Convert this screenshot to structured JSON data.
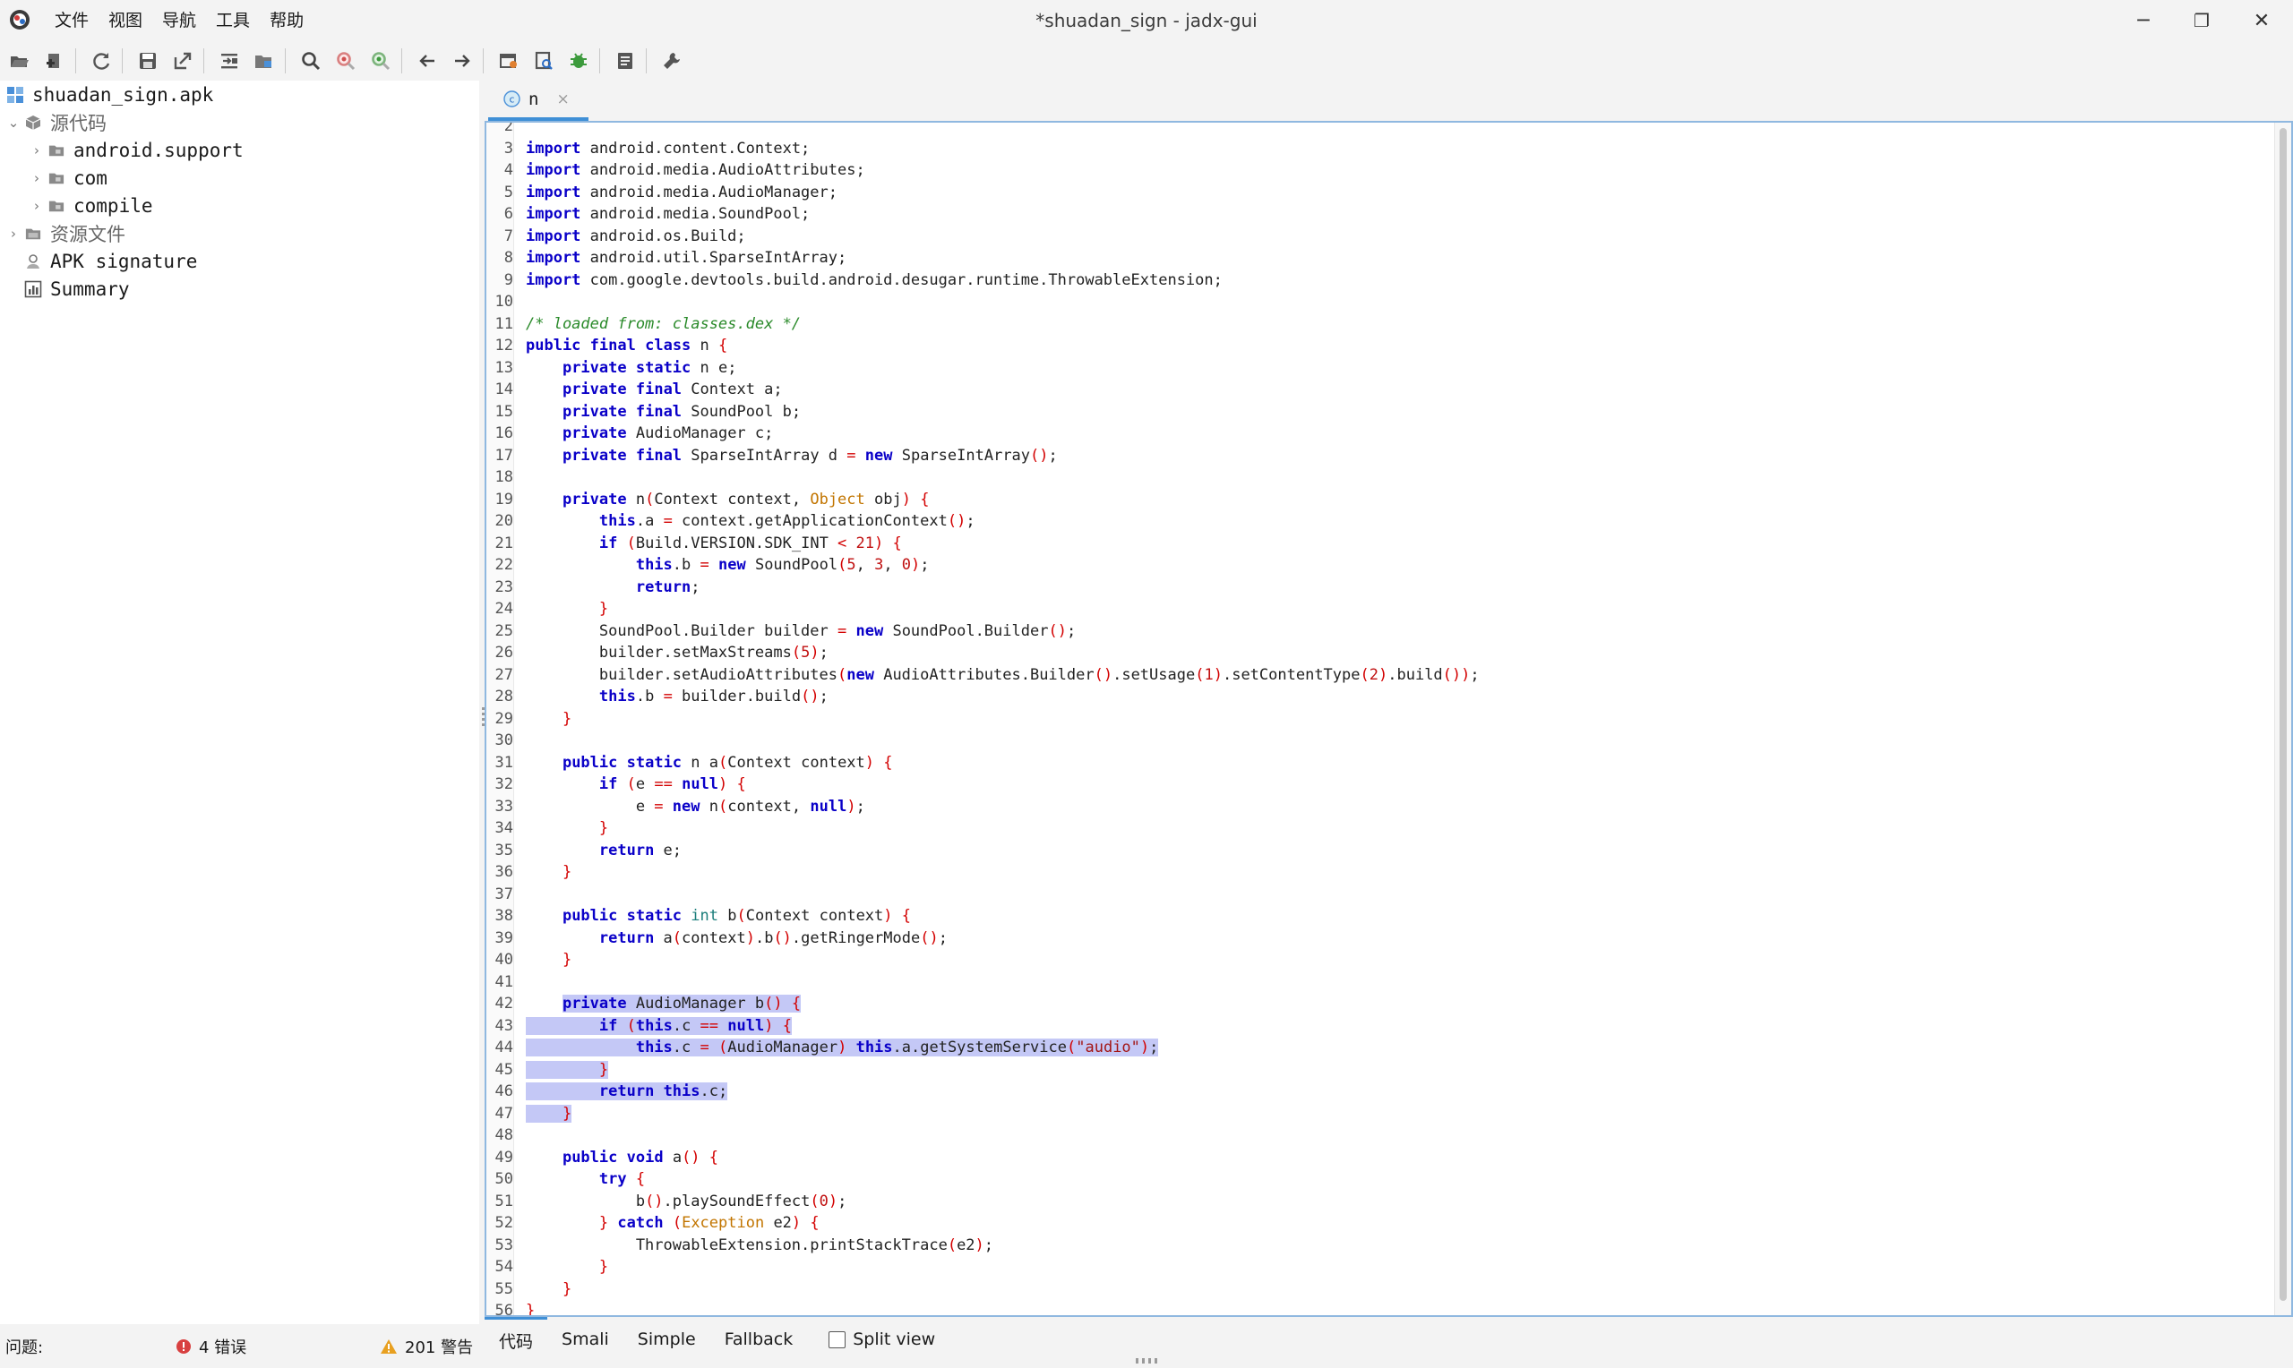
{
  "window": {
    "title": "*shuadan_sign - jadx-gui",
    "minimize_glyph": "─",
    "maximize_glyph": "❐",
    "close_glyph": "✕"
  },
  "menu": [
    "文件",
    "视图",
    "导航",
    "工具",
    "帮助"
  ],
  "toolbar_icons": [
    "open-file-icon",
    "add-files-icon",
    "reload-icon",
    "save-icon",
    "export-icon",
    "sync-icon",
    "flatten-packages-icon",
    "search-icon",
    "find-usage-icon",
    "find-class-icon",
    "back-icon",
    "forward-icon",
    "deobfuscation-icon",
    "quick-tabs-icon",
    "debugger-icon",
    "log-viewer-icon",
    "preferences-icon"
  ],
  "tree": {
    "root": "shuadan_sign.apk",
    "source_code": "源代码",
    "packages": [
      "android.support",
      "com",
      "compile"
    ],
    "resources": "资源文件",
    "apk_signature": "APK signature",
    "summary": "Summary"
  },
  "tab": {
    "label": "n",
    "close": "×"
  },
  "code_lines": [
    {
      "n": "2",
      "t": ""
    },
    {
      "n": "3",
      "h": "<span class='kw'>import</span> android.content.Context;"
    },
    {
      "n": "4",
      "h": "<span class='kw'>import</span> android.media.AudioAttributes;"
    },
    {
      "n": "5",
      "h": "<span class='kw'>import</span> android.media.AudioManager;"
    },
    {
      "n": "6",
      "h": "<span class='kw'>import</span> android.media.SoundPool;"
    },
    {
      "n": "7",
      "h": "<span class='kw'>import</span> android.os.Build;"
    },
    {
      "n": "8",
      "h": "<span class='kw'>import</span> android.util.SparseIntArray;"
    },
    {
      "n": "9",
      "h": "<span class='kw'>import</span> com.google.devtools.build.android.desugar.runtime.ThrowableExtension;"
    },
    {
      "n": "10",
      "h": ""
    },
    {
      "n": "11",
      "h": "<span class='cm'>/* loaded from: classes.dex */</span>"
    },
    {
      "n": "12",
      "h": "<span class='kw'>public</span> <span class='kw'>final</span> <span class='kw'>class</span> n <span class='pu'>{</span>"
    },
    {
      "n": "13",
      "h": "    <span class='kw'>private</span> <span class='kw'>static</span> n e;"
    },
    {
      "n": "14",
      "h": "    <span class='kw'>private</span> <span class='kw'>final</span> Context a;"
    },
    {
      "n": "15",
      "h": "    <span class='kw'>private</span> <span class='kw'>final</span> SoundPool b;"
    },
    {
      "n": "16",
      "h": "    <span class='kw'>private</span> AudioManager c;"
    },
    {
      "n": "17",
      "h": "    <span class='kw'>private</span> <span class='kw'>final</span> SparseIntArray d <span class='pu'>=</span> <span class='kw'>new</span> SparseIntArray<span class='pu'>()</span>;"
    },
    {
      "n": "18",
      "h": ""
    },
    {
      "n": "19",
      "h": "    <span class='kw'>private</span> n<span class='pu'>(</span>Context context, <span class='ob'>Object</span> obj<span class='pu'>)</span> <span class='pu'>{</span>"
    },
    {
      "n": "20",
      "h": "        <span class='kw'>this</span>.a <span class='pu'>=</span> context.getApplicationContext<span class='pu'>()</span>;"
    },
    {
      "n": "21",
      "h": "        <span class='kw'>if</span> <span class='pu'>(</span>Build.VERSION.SDK_INT <span class='pu'>&lt;</span> <span class='nu'>21</span><span class='pu'>)</span> <span class='pu'>{</span>"
    },
    {
      "n": "22",
      "h": "            <span class='kw'>this</span>.b <span class='pu'>=</span> <span class='kw'>new</span> SoundPool<span class='pu'>(</span><span class='nu'>5</span>, <span class='nu'>3</span>, <span class='nu'>0</span><span class='pu'>)</span>;"
    },
    {
      "n": "23",
      "h": "            <span class='kw'>return</span>;"
    },
    {
      "n": "24",
      "h": "        <span class='pu'>}</span>"
    },
    {
      "n": "25",
      "h": "        SoundPool.Builder builder <span class='pu'>=</span> <span class='kw'>new</span> SoundPool.Builder<span class='pu'>()</span>;"
    },
    {
      "n": "26",
      "h": "        builder.setMaxStreams<span class='pu'>(</span><span class='nu'>5</span><span class='pu'>)</span>;"
    },
    {
      "n": "27",
      "h": "        builder.setAudioAttributes<span class='pu'>(</span><span class='kw'>new</span> AudioAttributes.Builder<span class='pu'>()</span>.setUsage<span class='pu'>(</span><span class='nu'>1</span><span class='pu'>)</span>.setContentType<span class='pu'>(</span><span class='nu'>2</span><span class='pu'>)</span>.build<span class='pu'>())</span>;"
    },
    {
      "n": "28",
      "h": "        <span class='kw'>this</span>.b <span class='pu'>=</span> builder.build<span class='pu'>()</span>;"
    },
    {
      "n": "29",
      "h": "    <span class='pu'>}</span>"
    },
    {
      "n": "30",
      "h": ""
    },
    {
      "n": "31",
      "h": "    <span class='kw'>public</span> <span class='kw'>static</span> n a<span class='pu'>(</span>Context context<span class='pu'>)</span> <span class='pu'>{</span>"
    },
    {
      "n": "32",
      "h": "        <span class='kw'>if</span> <span class='pu'>(</span>e <span class='pu'>==</span> <span class='kw'>null</span><span class='pu'>)</span> <span class='pu'>{</span>"
    },
    {
      "n": "33",
      "h": "            e <span class='pu'>=</span> <span class='kw'>new</span> n<span class='pu'>(</span>context, <span class='kw'>null</span><span class='pu'>)</span>;"
    },
    {
      "n": "34",
      "h": "        <span class='pu'>}</span>"
    },
    {
      "n": "35",
      "h": "        <span class='kw'>return</span> e;"
    },
    {
      "n": "36",
      "h": "    <span class='pu'>}</span>"
    },
    {
      "n": "37",
      "h": ""
    },
    {
      "n": "38",
      "h": "    <span class='kw'>public</span> <span class='kw'>static</span> <span class='ty'>int</span> b<span class='pu'>(</span>Context context<span class='pu'>)</span> <span class='pu'>{</span>"
    },
    {
      "n": "39",
      "h": "        <span class='kw'>return</span> a<span class='pu'>(</span>context<span class='pu'>)</span>.b<span class='pu'>()</span>.getRingerMode<span class='pu'>()</span>;"
    },
    {
      "n": "40",
      "h": "    <span class='pu'>}</span>"
    },
    {
      "n": "41",
      "h": ""
    },
    {
      "n": "42",
      "h": "    <span class='sel'><span class='kw'>private</span> AudioManager b<span class='pu'>()</span> <span class='pu'>{</span></span>",
      "sel": true
    },
    {
      "n": "43",
      "h": "<span class='sel'>        <span class='kw'>if</span> <span class='pu'>(</span><span class='kw'>this</span>.c <span class='pu'>==</span> <span class='kw'>null</span><span class='pu'>)</span> <span class='pu'>{</span></span>"
    },
    {
      "n": "44",
      "h": "<span class='sel'>            <span class='kw'>this</span>.c <span class='pu'>=</span> <span class='pu'>(</span>AudioManager<span class='pu'>)</span> <span class='kw'>this</span>.a.getSystemService<span class='pu'>(</span><span class='st'>\"audio\"</span><span class='pu'>)</span>;</span>"
    },
    {
      "n": "45",
      "h": "<span class='sel'>        <span class='pu'>}</span></span>"
    },
    {
      "n": "46",
      "h": "<span class='sel'>        <span class='kw'>return</span> <span class='kw'>this</span>.c;</span>"
    },
    {
      "n": "47",
      "h": "<span class='sel'>    <span class='pu'>}</span></span>"
    },
    {
      "n": "48",
      "h": ""
    },
    {
      "n": "49",
      "h": "    <span class='kw'>public</span> <span class='kw'>void</span> a<span class='pu'>()</span> <span class='pu'>{</span>"
    },
    {
      "n": "50",
      "h": "        <span class='kw'>try</span> <span class='pu'>{</span>"
    },
    {
      "n": "51",
      "h": "            b<span class='pu'>()</span>.playSoundEffect<span class='pu'>(</span><span class='nu'>0</span><span class='pu'>)</span>;"
    },
    {
      "n": "52",
      "h": "        <span class='pu'>}</span> <span class='kw'>catch</span> <span class='pu'>(</span><span class='ob'>Exception</span> e2<span class='pu'>)</span> <span class='pu'>{</span>"
    },
    {
      "n": "53",
      "h": "            ThrowableExtension.printStackTrace<span class='pu'>(</span>e2<span class='pu'>)</span>;"
    },
    {
      "n": "54",
      "h": "        <span class='pu'>}</span>"
    },
    {
      "n": "55",
      "h": "    <span class='pu'>}</span>"
    },
    {
      "n": "56",
      "h": "<span class='pu'>}</span>"
    }
  ],
  "view_tabs": [
    "代码",
    "Smali",
    "Simple",
    "Fallback"
  ],
  "split_view": "Split view",
  "status": {
    "label": "问题:",
    "errors": "4 错误",
    "warnings": "201 警告"
  },
  "colors": {
    "keyword": "#0a00c8",
    "punct": "#d30000",
    "comment": "#2a8a2a",
    "selection": "#c4c8f6",
    "accent": "#3f8fd6"
  }
}
